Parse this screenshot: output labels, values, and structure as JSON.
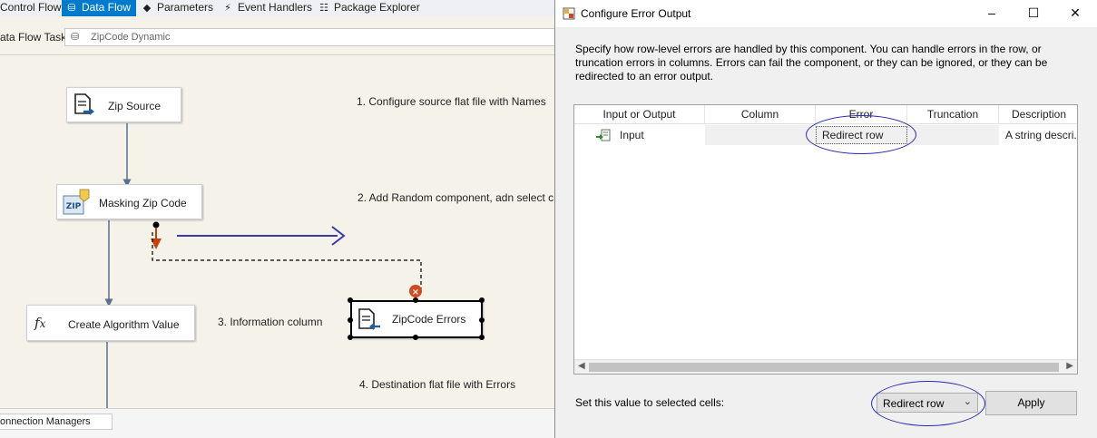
{
  "designer": {
    "tabs": [
      {
        "label": "Control Flow",
        "icon": "control-flow-icon"
      },
      {
        "label": "Data Flow",
        "icon": "data-flow-icon"
      },
      {
        "label": "Parameters",
        "icon": "parameters-icon"
      },
      {
        "label": "Event Handlers",
        "icon": "event-handlers-icon"
      },
      {
        "label": "Package Explorer",
        "icon": "package-explorer-icon"
      }
    ],
    "task_label": "ata Flow Task:",
    "task_value": "ZipCode Dynamic",
    "nodes": {
      "zip_source": "Zip Source",
      "masking": "Masking Zip Code",
      "algorithm": "Create Algorithm Value",
      "errors": "ZipCode Errors"
    },
    "notes": {
      "n1": "1. Configure source flat file with Names",
      "n2": "2. Add Random component, adn select c",
      "n3": "3. Information column",
      "n4": "4. Destination flat file with Errors"
    },
    "connection_managers_tab": "onnection Managers",
    "annotation_color": "#3a3aa8",
    "accent_color": "#007acc",
    "error_path_color": "#c8400a"
  },
  "dialog": {
    "title": "Configure Error Output",
    "description": "Specify how row-level errors are handled by this component. You can handle errors in the row, or truncation errors in columns. Errors can fail the component, or they can be ignored, or they can be redirected to an error output.",
    "columns": [
      "Input or Output",
      "Column",
      "Error",
      "Truncation",
      "Description"
    ],
    "row": {
      "input": "Input",
      "column": "",
      "error": "Redirect row",
      "truncation": "",
      "description": "A string descri..."
    },
    "set_label": "Set this value to selected cells:",
    "set_value": "Redirect row",
    "apply_label": "Apply",
    "window_buttons": {
      "minimize": "–",
      "maximize": "☐",
      "close": "✕"
    }
  }
}
